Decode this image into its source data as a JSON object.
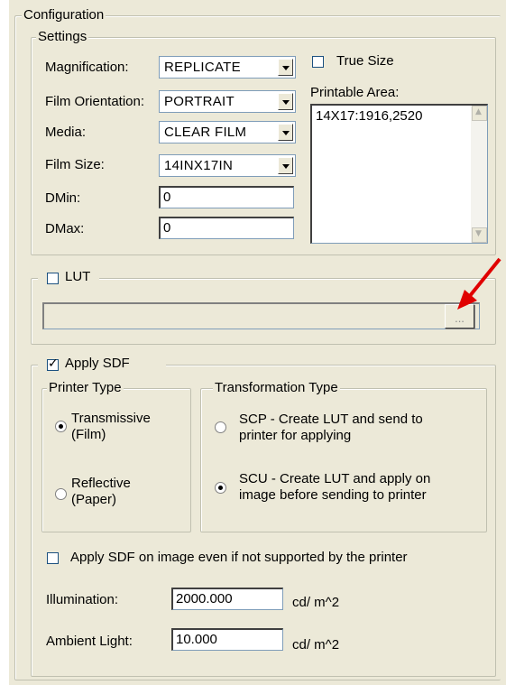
{
  "configuration": {
    "title": "Configuration",
    "settings": {
      "title": "Settings",
      "magnification": {
        "label": "Magnification:",
        "value": "REPLICATE"
      },
      "film_orientation": {
        "label": "Film Orientation:",
        "value": "PORTRAIT"
      },
      "media": {
        "label": "Media:",
        "value": "CLEAR FILM"
      },
      "film_size": {
        "label": "Film Size:",
        "value": "14INX17IN"
      },
      "dmin": {
        "label": "DMin:",
        "value": "0"
      },
      "dmax": {
        "label": "DMax:",
        "value": "0"
      },
      "true_size": {
        "label": "True Size",
        "checked": false
      },
      "printable_area": {
        "label": "Printable Area:",
        "items": [
          "14X17:1916,2520"
        ]
      }
    },
    "lut": {
      "label": "LUT",
      "checked": false,
      "path": "",
      "browse_label": "...",
      "annotation_arrow_color": "#e00000"
    },
    "apply_sdf": {
      "label": "Apply SDF",
      "checked": true,
      "printer_type": {
        "title": "Printer Type",
        "options": [
          {
            "line1": "Transmissive",
            "line2": "(Film)",
            "selected": true
          },
          {
            "line1": "Reflective",
            "line2": "(Paper)",
            "selected": false
          }
        ]
      },
      "transformation_type": {
        "title": "Transformation Type",
        "options": [
          {
            "line1": "SCP - Create LUT and send to",
            "line2": "printer for applying",
            "selected": false
          },
          {
            "line1": "SCU - Create LUT and apply on",
            "line2": "image before sending to printer",
            "selected": true
          }
        ]
      },
      "force_apply": {
        "label": "Apply SDF on image even if not supported by the printer",
        "checked": false
      },
      "illumination": {
        "label": "Illumination:",
        "value": "2000.000",
        "unit": "cd/ m^2"
      },
      "ambient_light": {
        "label": "Ambient Light:",
        "value": "10.000",
        "unit": "cd/ m^2"
      }
    }
  }
}
